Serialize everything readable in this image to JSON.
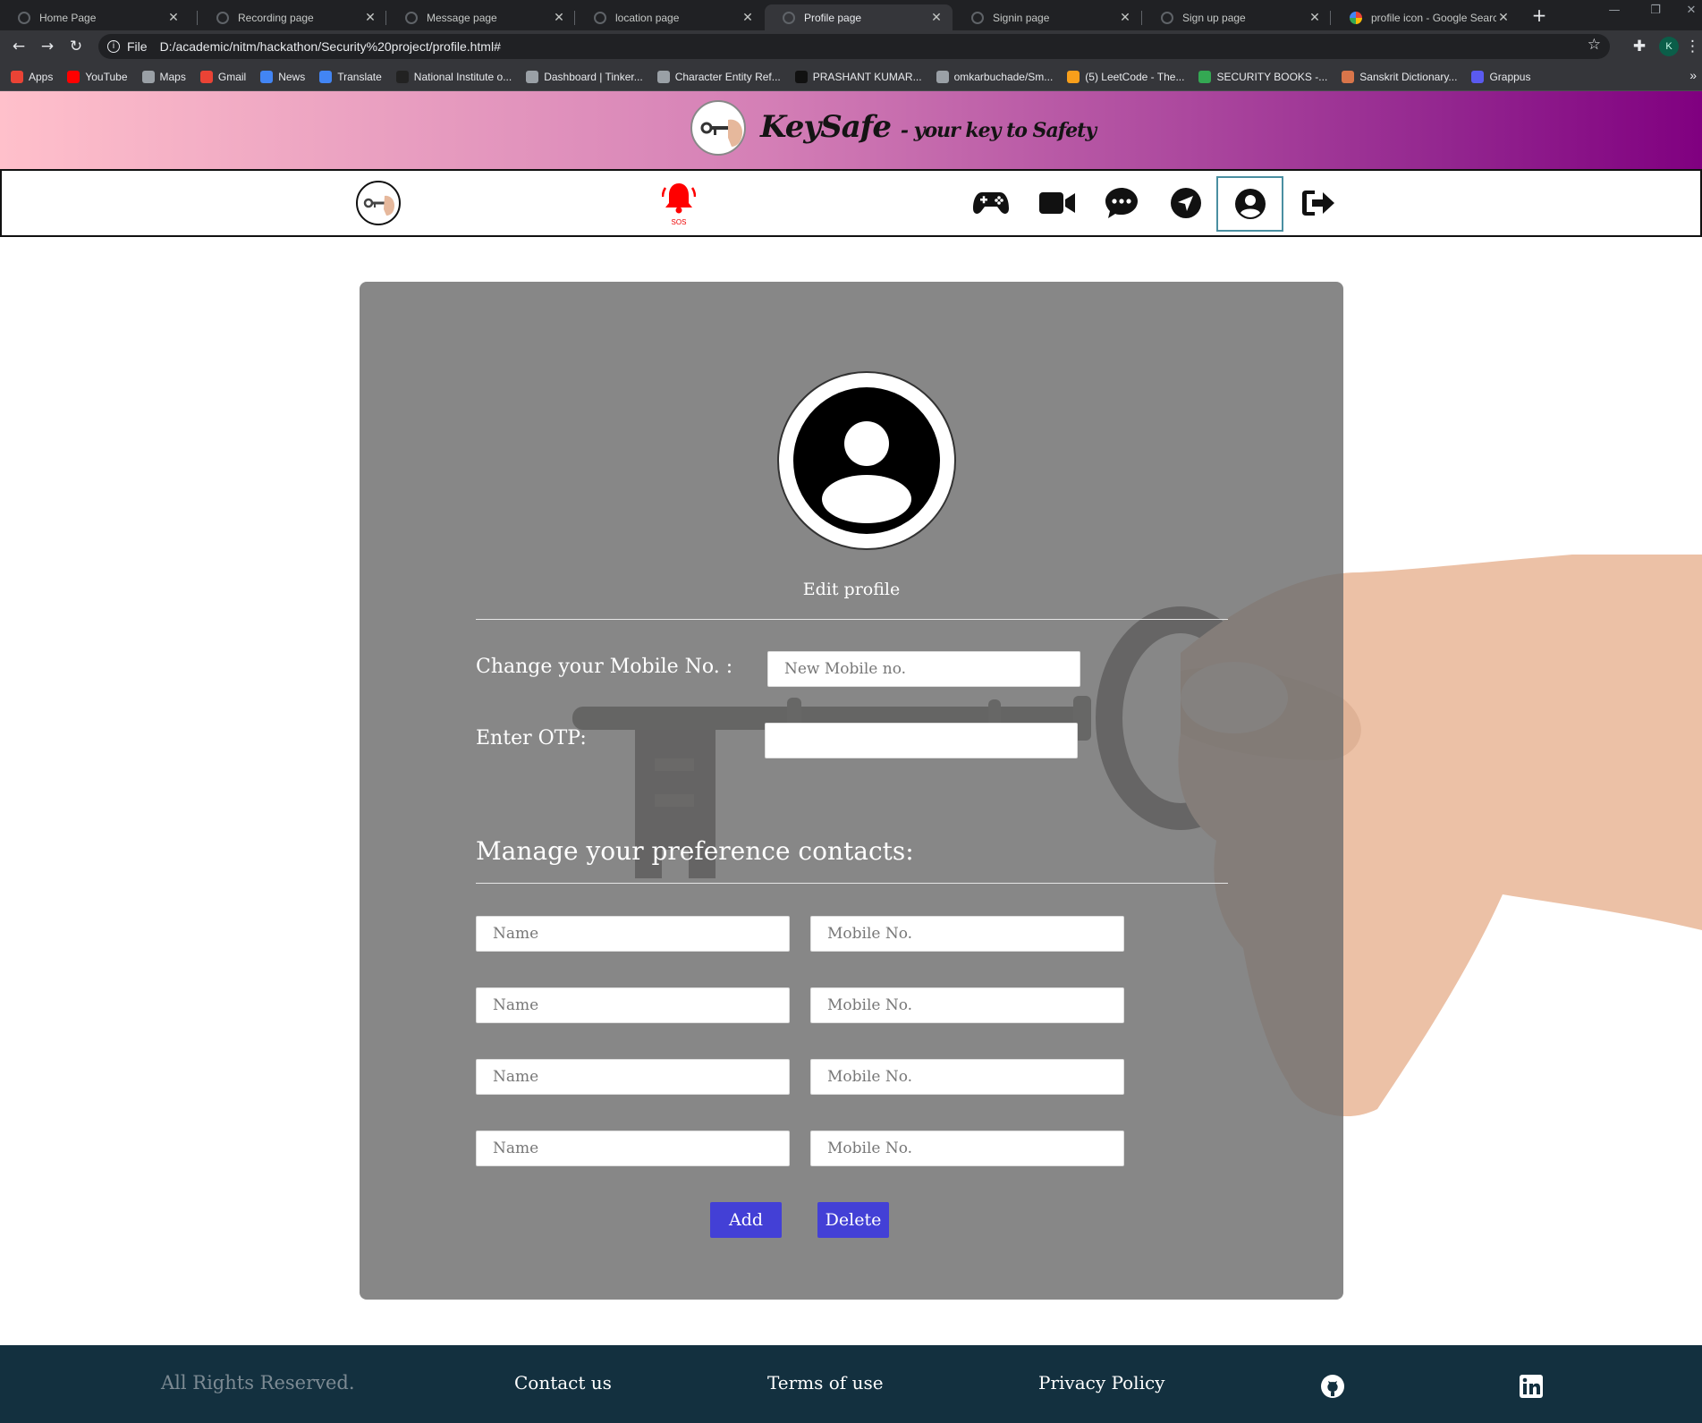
{
  "browser": {
    "tabs": [
      {
        "title": "Home Page",
        "active": false
      },
      {
        "title": "Recording page",
        "active": false
      },
      {
        "title": "Message page",
        "active": false
      },
      {
        "title": "location page",
        "active": false
      },
      {
        "title": "Profile page",
        "active": true
      },
      {
        "title": "Signin page",
        "active": false
      },
      {
        "title": "Sign up page",
        "active": false
      },
      {
        "title": "profile icon - Google Search",
        "active": false
      }
    ],
    "address": {
      "scheme_label": "File",
      "url": "D:/academic/nitm/hackathon/Security%20project/profile.html#"
    },
    "profile_initial": "K",
    "bookmarks": [
      {
        "label": "Apps",
        "color": "#ea4335"
      },
      {
        "label": "YouTube",
        "color": "#ff0000"
      },
      {
        "label": "Maps",
        "color": "#9aa0a6"
      },
      {
        "label": "Gmail",
        "color": "#ea4335"
      },
      {
        "label": "News",
        "color": "#4285f4"
      },
      {
        "label": "Translate",
        "color": "#4285f4"
      },
      {
        "label": "National Institute o...",
        "color": "#222222"
      },
      {
        "label": "Dashboard | Tinker...",
        "color": "#9aa0a6"
      },
      {
        "label": "Character Entity Ref...",
        "color": "#9aa0a6"
      },
      {
        "label": "PRASHANT KUMAR...",
        "color": "#111111"
      },
      {
        "label": "omkarbuchade/Sm...",
        "color": "#9aa0a6"
      },
      {
        "label": "(5) LeetCode - The...",
        "color": "#f89f1b"
      },
      {
        "label": "SECURITY BOOKS -...",
        "color": "#34a853"
      },
      {
        "label": "Sanskrit Dictionary...",
        "color": "#d9754a"
      },
      {
        "label": "Grappus",
        "color": "#5a5af0"
      }
    ]
  },
  "header": {
    "brand_name": "KeySafe",
    "tagline": "- your key to Safety",
    "gradient_start": "#ffc0cb",
    "gradient_end": "#800080"
  },
  "navbar": {
    "sos_label": "SOS",
    "sos_color": "#ff0000",
    "icons": [
      "gamepad-icon",
      "video-icon",
      "chat-icon",
      "location-arrow-icon",
      "user-circle-icon",
      "logout-icon"
    ],
    "active_icon": "user-circle-icon"
  },
  "profile": {
    "edit_link": "Edit profile",
    "mobile_label": "Change your Mobile No. :",
    "mobile_placeholder": "New Mobile no.",
    "otp_label": "Enter OTP:",
    "otp_placeholder": "",
    "contacts_title": "Manage your preference contacts:",
    "contacts": [
      {
        "name_placeholder": "Name",
        "mobile_placeholder": "Mobile No."
      },
      {
        "name_placeholder": "Name",
        "mobile_placeholder": "Mobile No."
      },
      {
        "name_placeholder": "Name",
        "mobile_placeholder": "Mobile No."
      },
      {
        "name_placeholder": "Name",
        "mobile_placeholder": "Mobile No."
      }
    ],
    "add_button": "Add",
    "delete_button": "Delete",
    "button_color": "#4340d6"
  },
  "footer": {
    "rights": "All Rights Reserved.",
    "contact": "Contact us",
    "terms": "Terms of use",
    "privacy": "Privacy Policy",
    "icons": [
      "github-icon",
      "linkedin-icon"
    ],
    "background": "#13303f"
  }
}
